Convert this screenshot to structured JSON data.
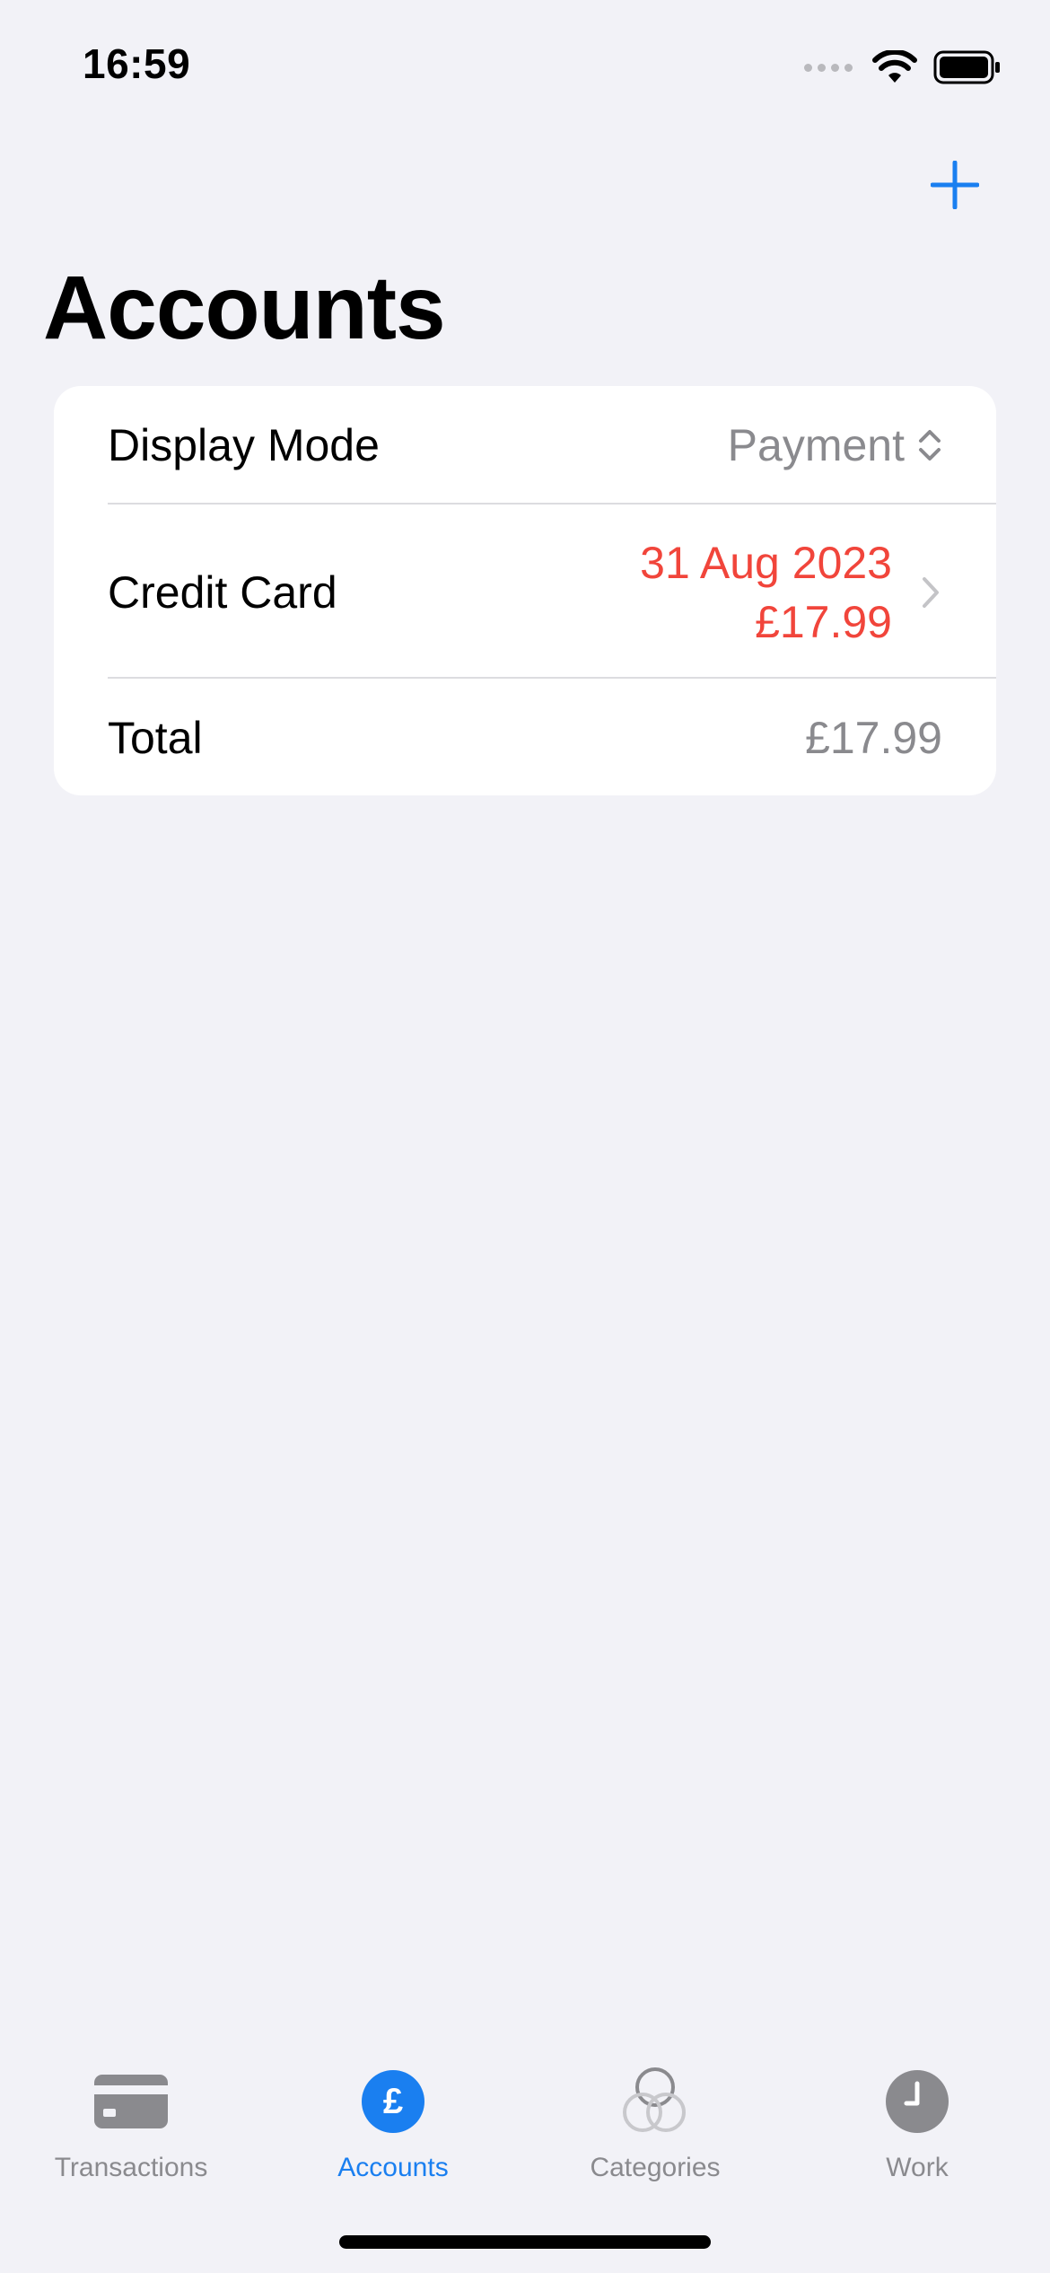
{
  "status_bar": {
    "time": "16:59"
  },
  "header": {
    "title": "Accounts",
    "add_icon": "plus-icon"
  },
  "accounts_card": {
    "display_mode": {
      "label": "Display Mode",
      "value": "Payment"
    },
    "accounts": [
      {
        "name": "Credit Card",
        "date": "31 Aug 2023",
        "amount": "£17.99"
      }
    ],
    "total": {
      "label": "Total",
      "value": "£17.99"
    }
  },
  "tab_bar": {
    "tabs": [
      {
        "label": "Transactions",
        "icon": "credit-card-icon",
        "active": false
      },
      {
        "label": "Accounts",
        "icon": "pound-circle-icon",
        "active": true
      },
      {
        "label": "Categories",
        "icon": "circles-icon",
        "active": false
      },
      {
        "label": "Work",
        "icon": "clock-icon",
        "active": false
      }
    ]
  },
  "colors": {
    "accent": "#1a7ff0",
    "negative": "#f1453b",
    "secondary_text": "#8a8a8e",
    "background": "#f2f2f7"
  }
}
